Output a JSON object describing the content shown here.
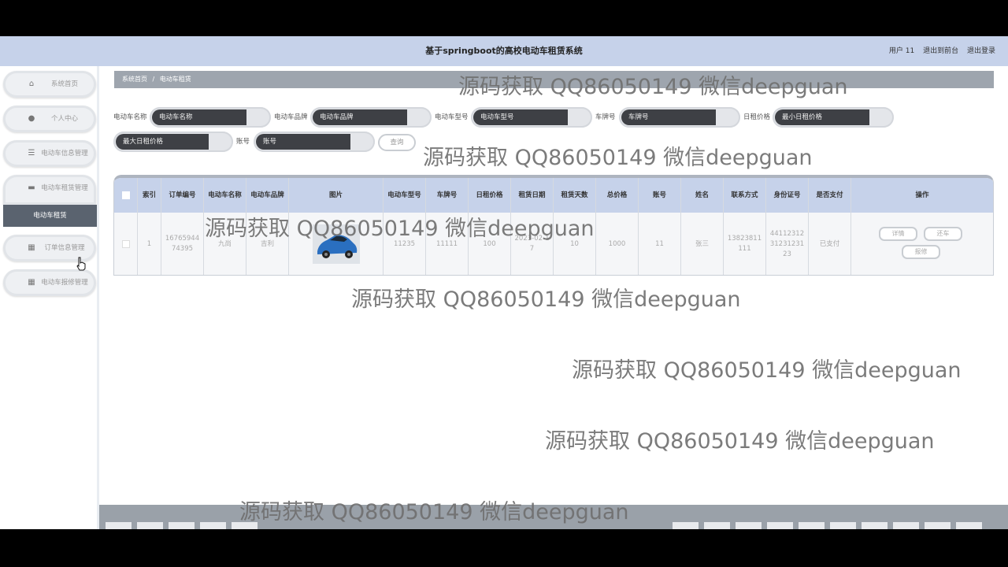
{
  "header": {
    "title": "基于springboot的高校电动车租赁系统",
    "user_label": "用户 11",
    "back_label": "退出到前台",
    "logout_label": "退出登录"
  },
  "sidebar": {
    "items": [
      {
        "label": "系统首页",
        "icon": "home-icon"
      },
      {
        "label": "个人中心",
        "icon": "user-icon"
      },
      {
        "label": "电动车信息管理",
        "icon": "list-icon"
      },
      {
        "label": "电动车租赁管理",
        "icon": "ticket-icon"
      },
      {
        "label": "订单信息管理",
        "icon": "grid-icon"
      },
      {
        "label": "电动车报修管理",
        "icon": "grid-icon"
      }
    ],
    "active_sub": "电动车租赁"
  },
  "breadcrumb": {
    "home": "系统首页",
    "separator": "/",
    "current": "电动车租赁"
  },
  "filters": {
    "name_label": "电动车名称",
    "name_placeholder": "电动车名称",
    "brand_label": "电动车品牌",
    "brand_placeholder": "电动车品牌",
    "model_label": "电动车型号",
    "model_placeholder": "电动车型号",
    "plate_label": "车牌号",
    "plate_placeholder": "车牌号",
    "price_label": "日租价格",
    "min_placeholder": "最小日租价格",
    "max_placeholder": "最大日租价格",
    "account_label": "账号",
    "account_placeholder": "账号",
    "query_label": "查询"
  },
  "table": {
    "headers": [
      "索引",
      "订单编号",
      "电动车名称",
      "电动车品牌",
      "图片",
      "电动车型号",
      "车牌号",
      "日租价格",
      "租赁日期",
      "租赁天数",
      "总价格",
      "账号",
      "姓名",
      "联系方式",
      "身份证号",
      "是否支付",
      "操作"
    ],
    "rows": [
      {
        "cells": [
          "1",
          "1676594474395",
          "九尚",
          "吉利",
          "",
          "11235",
          "11111",
          "100",
          "2023-02-17",
          "10",
          "1000",
          "11",
          "张三",
          "13823811111",
          "441123123123123123",
          "已支付"
        ],
        "actions": {
          "detail": "详情",
          "return": "还车",
          "repair": "报修"
        }
      }
    ]
  },
  "watermark": "源码获取 QQ86050149 微信deepguan"
}
